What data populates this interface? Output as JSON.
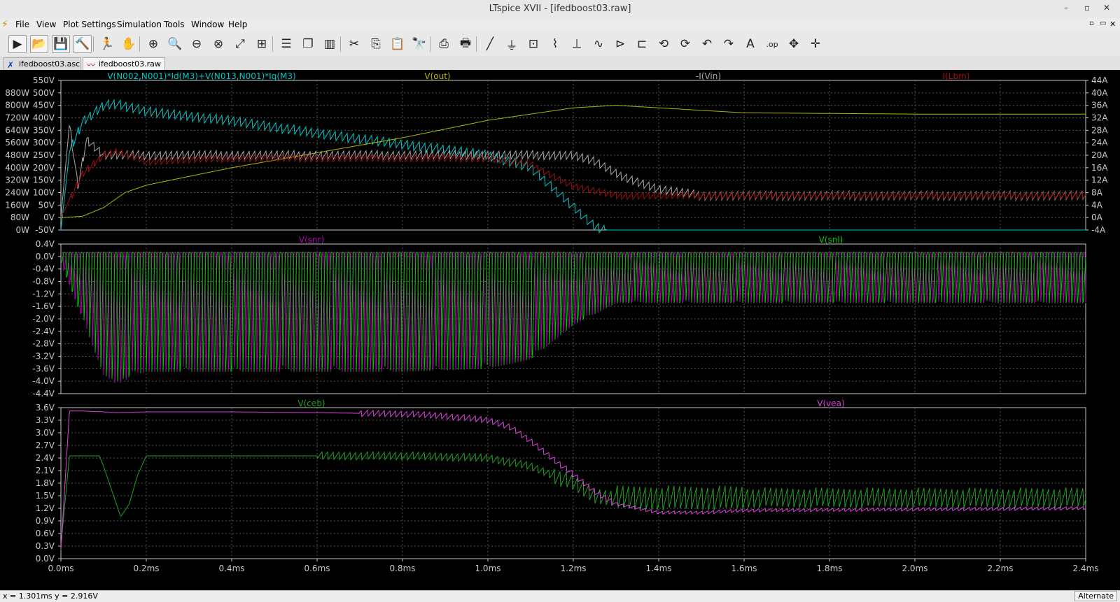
{
  "window": {
    "title": "LTspice XVII - [ifedboost03.raw]"
  },
  "menu": [
    "File",
    "View",
    "Plot Settings",
    "Simulation",
    "Tools",
    "Window",
    "Help"
  ],
  "tabs": [
    {
      "label": "ifedboost03.asc",
      "icon": "schematic-icon"
    },
    {
      "label": "ifedboost03.raw",
      "icon": "waveform-icon"
    }
  ],
  "toolbar": [
    "run-icon",
    "open-icon",
    "save-icon",
    "control-panel-icon",
    "halt-icon",
    "pan-icon",
    "zoom-in-icon",
    "zoom-area-icon",
    "zoom-out-icon",
    "zoom-cancel-icon",
    "autorange-icon",
    "manual-limits-icon",
    "tile-horizontal-icon",
    "cascade-icon",
    "tile-vertical-icon",
    "cut-icon",
    "copy-icon",
    "paste-icon",
    "find-icon",
    "print-icon",
    "print-setup-icon",
    "wire-icon",
    "ground-icon",
    "label-net-icon",
    "resistor-icon",
    "capacitor-icon",
    "inductor-icon",
    "diode-icon",
    "component-icon",
    "rotate-icon",
    "mirror-icon",
    "undo-icon",
    "redo-icon",
    "text-icon",
    "spice-directive-icon",
    "move-icon",
    "drag-icon"
  ],
  "status": {
    "cursor": "x = 1.301ms    y = 2.916V",
    "mode": "Alternate"
  },
  "colors": {
    "cyan": "#00c8c8",
    "yellow": "#b4b400",
    "gray": "#aaaaaa",
    "darkred": "#a01010",
    "purple": "#b400b4",
    "green": "#00c800",
    "magenta": "#e040e0",
    "green2": "#20a020",
    "grid": "#555555",
    "axis": "#c8c8c8"
  },
  "chart_data": [
    {
      "type": "line",
      "title": "",
      "xlabel": "",
      "xlim": [
        0,
        2.4
      ],
      "left_axis": {
        "ticks": [
          "880W",
          "800W",
          "720W",
          "640W",
          "560W",
          "480W",
          "400W",
          "320W",
          "240W",
          "160W",
          "80W",
          "0W"
        ]
      },
      "left_axis2": {
        "ylim": [
          -50,
          550
        ],
        "ticks": [
          "550V",
          "500V",
          "450V",
          "400V",
          "350V",
          "300V",
          "250V",
          "200V",
          "150V",
          "100V",
          "50V",
          "0V",
          "-50V"
        ]
      },
      "right_axis": {
        "ylim": [
          -4,
          44
        ],
        "ticks": [
          "44A",
          "40A",
          "36A",
          "32A",
          "28A",
          "24A",
          "20A",
          "16A",
          "12A",
          "8A",
          "4A",
          "0A",
          "-4A"
        ]
      },
      "series": [
        {
          "name": "V(N002,N001)*Id(M3)+V(N013,N001)*Ig(M3)",
          "color": "#00c8c8",
          "axis": "left",
          "x": [
            0,
            0.02,
            0.05,
            0.1,
            0.13,
            0.2,
            0.4,
            0.6,
            0.8,
            1.0,
            1.1,
            1.2,
            1.25,
            1.28,
            2.4
          ],
          "y": [
            0,
            500,
            690,
            800,
            810,
            760,
            700,
            620,
            550,
            480,
            400,
            150,
            20,
            0,
            0
          ]
        },
        {
          "name": "V(out)",
          "color": "#b4b400",
          "axis": "left2",
          "x": [
            0,
            0.05,
            0.1,
            0.15,
            0.2,
            0.4,
            0.6,
            0.8,
            1.0,
            1.2,
            1.3,
            1.4,
            1.6,
            2.0,
            2.4
          ],
          "y": [
            0,
            5,
            40,
            100,
            130,
            200,
            260,
            320,
            390,
            440,
            450,
            440,
            420,
            415,
            415
          ]
        },
        {
          "name": "-I(Vin)",
          "color": "#aaaaaa",
          "axis": "right",
          "x": [
            0,
            0.02,
            0.04,
            0.06,
            0.1,
            0.2,
            0.8,
            1.0,
            1.2,
            1.25,
            1.3,
            1.4,
            1.5,
            2.4
          ],
          "y": [
            0,
            30,
            10,
            25,
            20,
            20,
            20,
            20,
            20,
            18,
            14,
            9,
            7,
            7
          ]
        },
        {
          "name": "I(Lbm)",
          "color": "#a01010",
          "axis": "right",
          "x": [
            0,
            0.05,
            0.1,
            0.13,
            0.2,
            0.4,
            0.6,
            0.8,
            1.0,
            1.1,
            1.2,
            1.3,
            2.4
          ],
          "y": [
            0,
            14,
            20,
            21,
            18,
            19,
            19,
            19,
            19,
            17,
            10,
            7,
            7
          ]
        }
      ]
    },
    {
      "type": "line",
      "title": "",
      "xlim": [
        0,
        2.4
      ],
      "ylim": [
        -4.4,
        0.4
      ],
      "ticks": [
        "0.4V",
        "0.0V",
        "-0.4V",
        "-0.8V",
        "-1.2V",
        "-1.6V",
        "-2.0V",
        "-2.4V",
        "-2.8V",
        "-3.2V",
        "-3.6V",
        "-4.0V",
        "-4.4V"
      ],
      "series": [
        {
          "name": "V(snr)",
          "color": "#b400b4",
          "note_min": [
            [
              0,
              -0.2
            ],
            [
              0.1,
              -3.8
            ],
            [
              0.13,
              -4.1
            ],
            [
              0.2,
              -3.7
            ],
            [
              0.8,
              -3.7
            ],
            [
              1.0,
              -3.6
            ],
            [
              1.1,
              -3.3
            ],
            [
              1.2,
              -2.2
            ],
            [
              1.3,
              -1.5
            ],
            [
              2.4,
              -1.5
            ]
          ]
        },
        {
          "name": "V(snl)",
          "color": "#00c800",
          "note_min": [
            [
              0,
              -0.2
            ],
            [
              0.1,
              -3.8
            ],
            [
              0.13,
              -4.0
            ],
            [
              0.2,
              -3.7
            ],
            [
              0.8,
              -3.7
            ],
            [
              1.0,
              -3.6
            ],
            [
              1.1,
              -3.3
            ],
            [
              1.2,
              -2.2
            ],
            [
              1.3,
              -1.5
            ],
            [
              2.4,
              -1.5
            ]
          ]
        }
      ]
    },
    {
      "type": "line",
      "title": "",
      "xlim": [
        0,
        2.4
      ],
      "ylim": [
        0,
        3.6
      ],
      "ticks": [
        "3.6V",
        "3.3V",
        "3.0V",
        "2.7V",
        "2.4V",
        "2.1V",
        "1.8V",
        "1.5V",
        "1.2V",
        "0.9V",
        "0.6V",
        "0.3V",
        "0.0V"
      ],
      "xticks": [
        "0.0ms",
        "0.2ms",
        "0.4ms",
        "0.6ms",
        "0.8ms",
        "1.0ms",
        "1.2ms",
        "1.4ms",
        "1.6ms",
        "1.8ms",
        "2.0ms",
        "2.2ms",
        "2.4ms"
      ],
      "series": [
        {
          "name": "V(ceb)",
          "color": "#20a020",
          "x": [
            0,
            0.02,
            0.05,
            0.09,
            0.1,
            0.12,
            0.14,
            0.16,
            0.18,
            0.2,
            0.8,
            1.0,
            1.1,
            1.2,
            1.25,
            1.3,
            2.4
          ],
          "y": [
            0.3,
            2.45,
            2.45,
            2.45,
            2.2,
            1.6,
            1.0,
            1.3,
            2.0,
            2.45,
            2.45,
            2.4,
            2.2,
            1.8,
            1.5,
            1.45,
            1.45
          ]
        },
        {
          "name": "V(vea)",
          "color": "#e040e0",
          "x": [
            0,
            0.02,
            0.05,
            0.1,
            0.13,
            0.2,
            0.4,
            0.6,
            0.8,
            0.9,
            1.0,
            1.05,
            1.1,
            1.2,
            1.25,
            1.3,
            1.4,
            1.5,
            1.6,
            2.4
          ],
          "y": [
            0.2,
            3.52,
            3.52,
            3.5,
            3.48,
            3.5,
            3.5,
            3.48,
            3.45,
            3.4,
            3.3,
            3.15,
            2.8,
            2.0,
            1.6,
            1.3,
            1.1,
            1.1,
            1.15,
            1.2
          ]
        }
      ]
    }
  ]
}
